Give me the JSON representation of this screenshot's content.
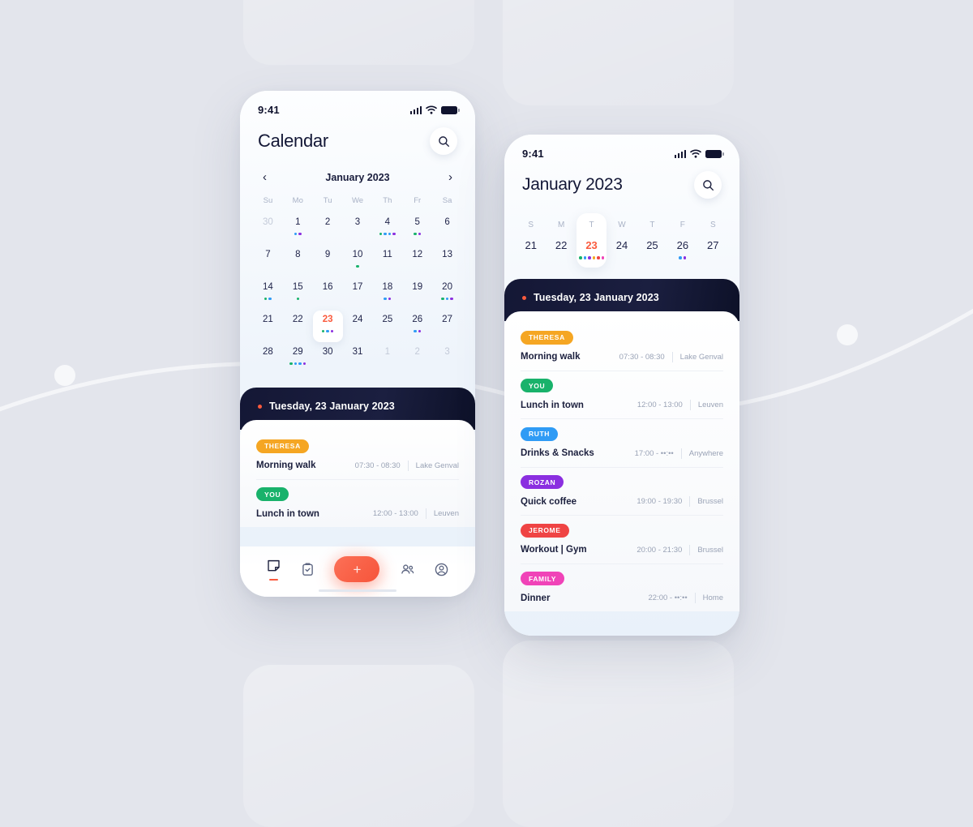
{
  "palette": {
    "background": "#e3e5ec",
    "accent": "#fa5a3d",
    "dark": "#141735",
    "green": "#19b26b",
    "blue": "#2f9bf5",
    "purple": "#8b2fe0",
    "orange": "#f5a623",
    "red": "#ef4444",
    "pink": "#f043b8"
  },
  "phone_main": {
    "status": {
      "time": "9:41",
      "signal_icon": "signal-bars-icon",
      "wifi_icon": "wifi-icon",
      "battery_icon": "battery-icon"
    },
    "header": {
      "title": "Calendar",
      "search_icon": "search-icon"
    },
    "month_nav": {
      "prev_icon": "chevron-left-icon",
      "label": "January 2023",
      "next_icon": "chevron-right-icon"
    },
    "weekday_labels": [
      "Su",
      "Mo",
      "Tu",
      "We",
      "Th",
      "Fr",
      "Sa"
    ],
    "weeks": [
      [
        {
          "day": "30",
          "muted": true,
          "dots": []
        },
        {
          "day": "1",
          "muted": false,
          "dots": [
            "blue",
            "purple"
          ]
        },
        {
          "day": "2",
          "muted": false,
          "dots": []
        },
        {
          "day": "3",
          "muted": false,
          "dots": []
        },
        {
          "day": "4",
          "muted": false,
          "dots": [
            "green",
            "blue",
            "blue",
            "purple"
          ]
        },
        {
          "day": "5",
          "muted": false,
          "dots": [
            "green",
            "purple"
          ]
        },
        {
          "day": "6",
          "muted": false,
          "dots": []
        }
      ],
      [
        {
          "day": "7",
          "muted": false,
          "dots": []
        },
        {
          "day": "8",
          "muted": false,
          "dots": []
        },
        {
          "day": "9",
          "muted": false,
          "dots": []
        },
        {
          "day": "10",
          "muted": false,
          "dots": [
            "green"
          ]
        },
        {
          "day": "11",
          "muted": false,
          "dots": []
        },
        {
          "day": "12",
          "muted": false,
          "dots": []
        },
        {
          "day": "13",
          "muted": false,
          "dots": []
        }
      ],
      [
        {
          "day": "14",
          "muted": false,
          "dots": [
            "green",
            "blue"
          ]
        },
        {
          "day": "15",
          "muted": false,
          "dots": [
            "green"
          ]
        },
        {
          "day": "16",
          "muted": false,
          "dots": []
        },
        {
          "day": "17",
          "muted": false,
          "dots": []
        },
        {
          "day": "18",
          "muted": false,
          "dots": [
            "blue",
            "purple"
          ]
        },
        {
          "day": "19",
          "muted": false,
          "dots": []
        },
        {
          "day": "20",
          "muted": false,
          "dots": [
            "green",
            "blue",
            "purple"
          ]
        }
      ],
      [
        {
          "day": "21",
          "muted": false,
          "dots": []
        },
        {
          "day": "22",
          "muted": false,
          "dots": []
        },
        {
          "day": "23",
          "muted": false,
          "today": true,
          "dots": [
            "green",
            "blue",
            "purple"
          ]
        },
        {
          "day": "24",
          "muted": false,
          "dots": []
        },
        {
          "day": "25",
          "muted": false,
          "dots": []
        },
        {
          "day": "26",
          "muted": false,
          "dots": [
            "blue",
            "purple"
          ]
        },
        {
          "day": "27",
          "muted": false,
          "dots": []
        }
      ],
      [
        {
          "day": "28",
          "muted": false,
          "dots": []
        },
        {
          "day": "29",
          "muted": false,
          "dots": [
            "green",
            "blue",
            "blue",
            "purple"
          ]
        },
        {
          "day": "30",
          "muted": false,
          "dots": []
        },
        {
          "day": "31",
          "muted": false,
          "dots": []
        },
        {
          "day": "1",
          "muted": true,
          "dots": []
        },
        {
          "day": "2",
          "muted": true,
          "dots": []
        },
        {
          "day": "3",
          "muted": true,
          "dots": []
        }
      ]
    ],
    "day_header": "Tuesday, 23 January 2023",
    "events": [
      {
        "tag": "THERESA",
        "color": "orange",
        "title": "Morning walk",
        "time": "07:30 - 08:30",
        "place": "Lake Genval"
      },
      {
        "tag": "YOU",
        "color": "green",
        "title": "Lunch in town",
        "time": "12:00 - 13:00",
        "place": "Leuven"
      }
    ],
    "bottom_nav": [
      {
        "name": "notes-icon",
        "active": true
      },
      {
        "name": "tasks-clipboard-icon",
        "active": false
      },
      {
        "name": "add-event-fab",
        "label": "+",
        "active": false
      },
      {
        "name": "contacts-group-icon",
        "active": false
      },
      {
        "name": "profile-icon",
        "active": false
      }
    ]
  },
  "phone_day": {
    "status": {
      "time": "9:41",
      "signal_icon": "signal-bars-icon",
      "wifi_icon": "wifi-icon",
      "battery_icon": "battery-icon"
    },
    "header": {
      "title": "January 2023",
      "search_icon": "search-icon"
    },
    "week": [
      {
        "dow": "S",
        "day": "21",
        "selected": false,
        "dots": []
      },
      {
        "dow": "M",
        "day": "22",
        "selected": false,
        "dots": []
      },
      {
        "dow": "T",
        "day": "23",
        "selected": true,
        "dots": [
          "green",
          "blue",
          "purple",
          "orange",
          "red",
          "pink"
        ]
      },
      {
        "dow": "W",
        "day": "24",
        "selected": false,
        "dots": []
      },
      {
        "dow": "T",
        "day": "25",
        "selected": false,
        "dots": []
      },
      {
        "dow": "F",
        "day": "26",
        "selected": false,
        "dots": [
          "blue",
          "purple"
        ]
      },
      {
        "dow": "S",
        "day": "27",
        "selected": false,
        "dots": []
      }
    ],
    "day_header": "Tuesday, 23 January 2023",
    "events": [
      {
        "tag": "THERESA",
        "color": "orange",
        "title": "Morning walk",
        "time": "07:30 - 08:30",
        "place": "Lake Genval"
      },
      {
        "tag": "YOU",
        "color": "green",
        "title": "Lunch in town",
        "time": "12:00 - 13:00",
        "place": "Leuven"
      },
      {
        "tag": "RUTH",
        "color": "blue",
        "title": "Drinks & Snacks",
        "time": "17:00 - ••:••",
        "place": "Anywhere"
      },
      {
        "tag": "ROZAN",
        "color": "purple",
        "title": "Quick coffee",
        "time": "19:00 - 19:30",
        "place": "Brussel"
      },
      {
        "tag": "JEROME",
        "color": "red",
        "title": "Workout | Gym",
        "time": "20:00 - 21:30",
        "place": "Brussel"
      },
      {
        "tag": "FAMILY",
        "color": "pink",
        "title": "Dinner",
        "time": "22:00 - ••:••",
        "place": "Home"
      }
    ]
  }
}
